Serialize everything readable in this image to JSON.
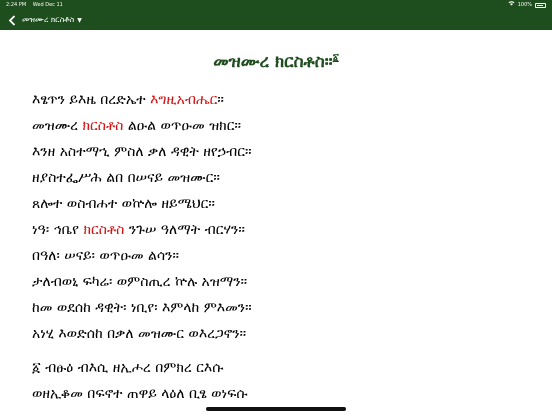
{
  "status_bar": {
    "time": "2:24 PM",
    "date": "Wed Dec 11",
    "battery_text": "100%"
  },
  "nav": {
    "back_icon": "chevron-left-icon",
    "title": "መዝሙረ ክርስቶስ",
    "caret": "▼"
  },
  "psalm": {
    "title": "መዝሙረ ክርስቶስ።",
    "footnote_marker": "፩"
  },
  "colors": {
    "header_bg": "#1e4d1e",
    "title_green": "#1e4d1e",
    "highlight_red": "#d41414"
  },
  "lines": [
    {
      "pre": "እፄጥን ይእዜ በረድኤተ ",
      "hl": "እግዚአብሔር",
      "post": "።"
    },
    {
      "pre": "መዝሙረ ",
      "hl": "ክርስቶስ",
      "post": " ልዑል ወጥዑመ ዝክር።"
    },
    {
      "pre": "እንዘ አስተማኂ ምስለ ቃለ ዳዊት ዘየኃብር።",
      "hl": "",
      "post": ""
    },
    {
      "pre": "ዘያስተፌሥሕ ልበ በሠናይ መዝሙር።",
      "hl": "",
      "post": ""
    },
    {
      "pre": "ጸሎተ ወስብሐተ ወኵሎ ዘይሜህር።",
      "hl": "",
      "post": ""
    },
    {
      "pre": "ነዓ፡ ኅቤየ ",
      "hl": "ክርስቶስ",
      "post": " ንጉሠ ዓለማት ብርሃን።"
    },
    {
      "pre": "በዓለ፡ ሠናይ፡ ወጥዑመ ልሳን።",
      "hl": "",
      "post": ""
    },
    {
      "pre": "ታለብወኒ ፍካሬ፡ ወምስጢረ ኵሉ አዝማን።",
      "hl": "",
      "post": ""
    },
    {
      "pre": "ከመ ወደሰከ ዳዊት፡ ነቢየ፡ እምላከ ምእመን።",
      "hl": "",
      "post": ""
    },
    {
      "pre": "አነሂ እወድሰከ በቃለ መዝሙር ወእረጋኖን።",
      "hl": "",
      "post": ""
    },
    {
      "pre": "፩ ብፁዕ ብእሲ ዘኢሖረ በምክረ ርእሱ",
      "hl": "",
      "post": ""
    },
    {
      "pre": "ወዘኢቆመ በፍኖተ ጠዋይ ላዕለ ቢፄ ወነፍሱ",
      "hl": "",
      "post": ""
    }
  ]
}
